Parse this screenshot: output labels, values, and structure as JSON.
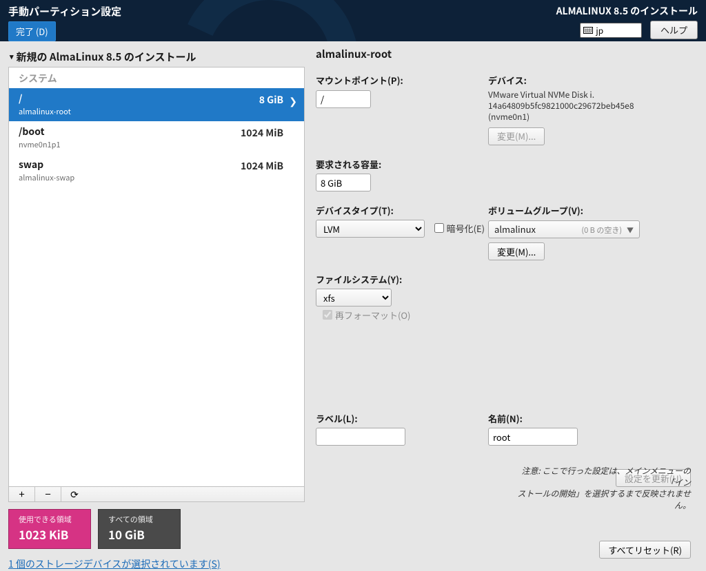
{
  "header": {
    "screen_title": "手動パーティション設定",
    "done_label": "完了 (D)",
    "installer_title": "ALMALINUX 8.5 のインストール",
    "kbd_layout": "jp",
    "help_label": "ヘルプ"
  },
  "left": {
    "list_heading": "新規の AlmaLinux 8.5 のインストール",
    "section_label": "システム",
    "items": [
      {
        "mount": "/",
        "dev": "almalinux-root",
        "size": "8 GiB",
        "selected": true
      },
      {
        "mount": "/boot",
        "dev": "nvme0n1p1",
        "size": "1024 MiB",
        "selected": false
      },
      {
        "mount": "swap",
        "dev": "almalinux-swap",
        "size": "1024 MiB",
        "selected": false
      }
    ],
    "toolbar": {
      "add": "+",
      "remove": "−",
      "reload": "⟳"
    },
    "space": {
      "avail_label": "使用できる領域",
      "avail_value": "1023 KiB",
      "total_label": "すべての領域",
      "total_value": "10 GiB"
    },
    "storage_link": "1 個のストレージデバイスが選択されています(S)"
  },
  "right": {
    "title": "almalinux-root",
    "mountpoint_label": "マウントポイント(P):",
    "mountpoint_value": "/",
    "devices_label": "デバイス:",
    "devices_text1": "VMware Virtual NVMe Disk i.",
    "devices_text2": "14a64809b5fc9821000c29672beb45e8",
    "devices_text3": "(nvme0n1)",
    "modify_m_label": "変更(M)...",
    "desired_label": "要求される容量:",
    "desired_value": "8 GiB",
    "devtype_label": "デバイスタイプ(T):",
    "devtype_value": "LVM",
    "encrypt_label": "暗号化(E)",
    "vg_label": "ボリュームグループ(V):",
    "vg_value": "almalinux",
    "vg_hint": "(0 B の空き)",
    "fs_label": "ファイルシステム(Y):",
    "fs_value": "xfs",
    "reformat_label": "再フォーマット(O)",
    "label_label": "ラベル(L):",
    "label_value": "",
    "name_label": "名前(N):",
    "name_value": "root",
    "update_label": "設定を更新(U)",
    "warn_line1": "注意: ここで行った設定は、メインメニューの「イン",
    "warn_line2": "ストールの開始」を選択するまで反映されません。",
    "reset_all_label": "すべてリセット(R)"
  }
}
